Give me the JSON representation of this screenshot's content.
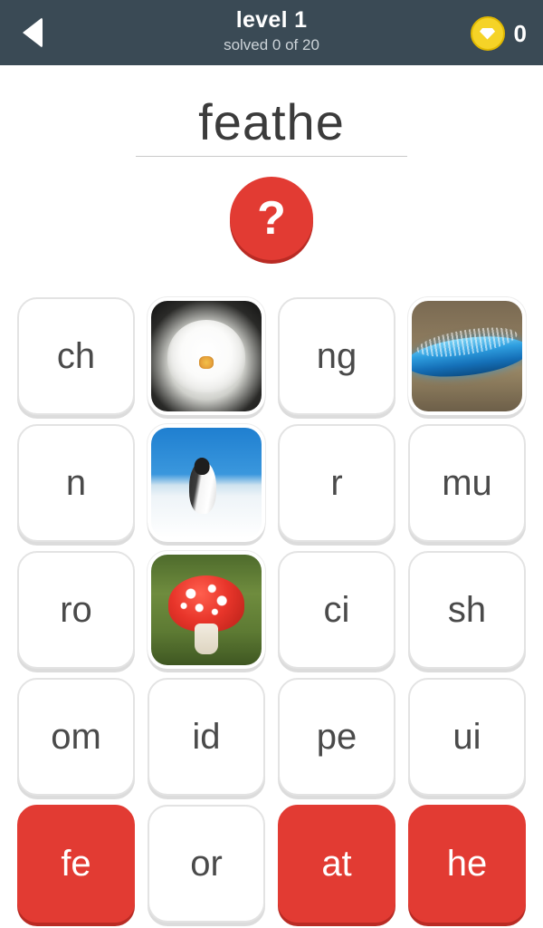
{
  "header": {
    "back_icon": "back-arrow-icon",
    "title": "level 1",
    "subtitle": "solved 0 of 20",
    "coin_icon": "gem-coin-icon",
    "coin_count": "0"
  },
  "puzzle": {
    "word": "feathe",
    "hint_label": "?",
    "hint_icon": "question-mark-icon"
  },
  "colors": {
    "header_bg": "#3a4a55",
    "accent_red": "#e23b33",
    "coin_yellow": "#f5d327",
    "tile_text": "#4a4a4a"
  },
  "tiles": [
    {
      "type": "letter",
      "label": "ch",
      "selected": false
    },
    {
      "type": "image",
      "label": "",
      "image": "orchid-flower-image",
      "pic": "pic-orchid",
      "selected": false
    },
    {
      "type": "letter",
      "label": "ng",
      "selected": false
    },
    {
      "type": "image",
      "label": "",
      "image": "blue-caterpillar-image",
      "pic": "pic-caterpillar",
      "selected": false
    },
    {
      "type": "letter",
      "label": "n",
      "selected": false
    },
    {
      "type": "image",
      "label": "",
      "image": "penguin-image",
      "pic": "pic-penguin",
      "selected": false
    },
    {
      "type": "letter",
      "label": "r",
      "selected": false
    },
    {
      "type": "letter",
      "label": "mu",
      "selected": false
    },
    {
      "type": "letter",
      "label": "ro",
      "selected": false
    },
    {
      "type": "image",
      "label": "",
      "image": "red-mushroom-image",
      "pic": "pic-mushroom",
      "selected": false
    },
    {
      "type": "letter",
      "label": "ci",
      "selected": false
    },
    {
      "type": "letter",
      "label": "sh",
      "selected": false
    },
    {
      "type": "letter",
      "label": "om",
      "selected": false
    },
    {
      "type": "letter",
      "label": "id",
      "selected": false
    },
    {
      "type": "letter",
      "label": "pe",
      "selected": false
    },
    {
      "type": "letter",
      "label": "ui",
      "selected": false
    },
    {
      "type": "letter",
      "label": "fe",
      "selected": true
    },
    {
      "type": "letter",
      "label": "or",
      "selected": false
    },
    {
      "type": "letter",
      "label": "at",
      "selected": true
    },
    {
      "type": "letter",
      "label": "he",
      "selected": true
    }
  ]
}
